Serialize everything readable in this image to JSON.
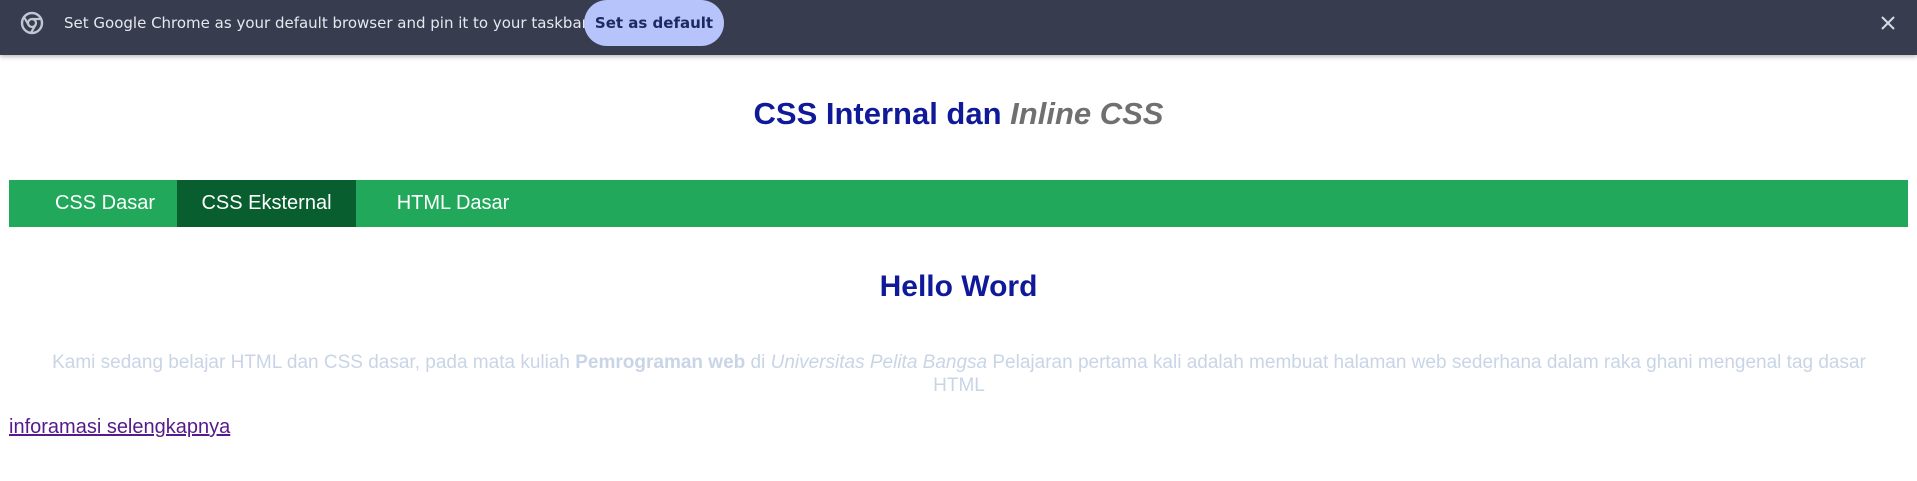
{
  "infobar": {
    "message": "Set Google Chrome as your default browser and pin it to your taskbar",
    "button_label": "Set as default",
    "icon": "chrome-icon",
    "close_icon": "close-icon",
    "background": "#373c4f",
    "button_color": "#b7c3fb"
  },
  "page": {
    "title_main": "CSS Internal dan ",
    "title_em": "Inline CSS",
    "title_color": "#101a99"
  },
  "nav": {
    "background": "#22a85a",
    "active_background": "#085e2f",
    "items": [
      {
        "label": "CSS Dasar",
        "active": false
      },
      {
        "label": "CSS Eksternal",
        "active": true
      },
      {
        "label": "HTML Dasar",
        "active": false
      }
    ]
  },
  "content": {
    "heading": "Hello Word",
    "paragraph": {
      "part1": "Kami sedang belajar HTML dan CSS dasar, pada mata kuliah ",
      "bold": "Pemrograman web",
      "part2": " di ",
      "italic": "Universitas Pelita Bangsa",
      "part3": " Pelajaran pertama kali adalah membuat halaman web sederhana dalam raka ghani mengenal tag dasar HTML"
    },
    "link_text": "inforamasi selengkapnya"
  }
}
